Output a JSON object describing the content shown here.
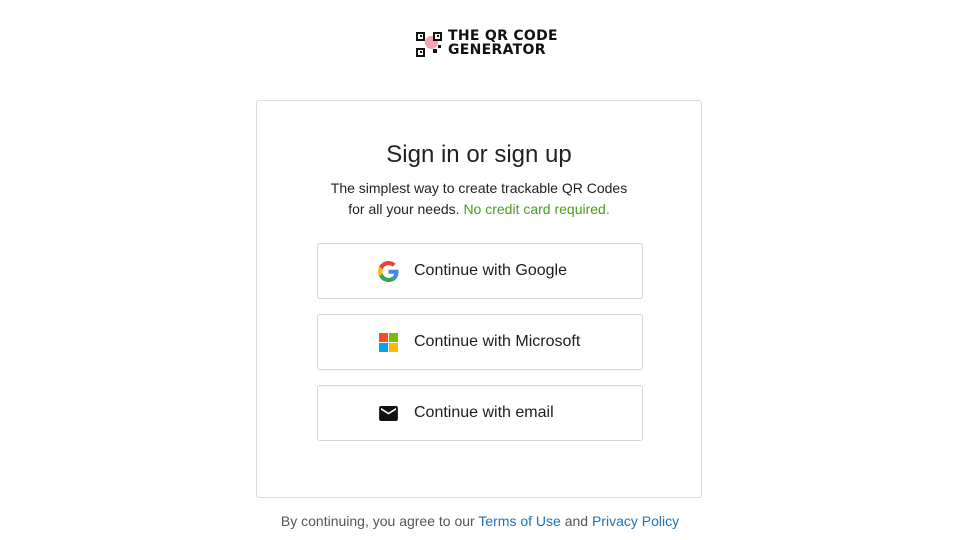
{
  "logo": {
    "line1": "THE QR CODE",
    "line2": "GENERATOR"
  },
  "card": {
    "title": "Sign in or sign up",
    "subtitle_line1": "The simplest way to create trackable QR Codes",
    "subtitle_line2": "for all your needs.",
    "subtitle_highlight": "No credit card required.",
    "highlight_color": "#4e9a1e"
  },
  "buttons": [
    {
      "label": "Continue with Google",
      "icon": "google-icon"
    },
    {
      "label": "Continue with Microsoft",
      "icon": "microsoft-icon"
    },
    {
      "label": "Continue with email",
      "icon": "email-icon"
    }
  ],
  "footer": {
    "prefix": "By continuing, you agree to our",
    "terms": "Terms of Use",
    "and": "and",
    "privacy": "Privacy Policy",
    "link_color": "#1a73b8"
  }
}
